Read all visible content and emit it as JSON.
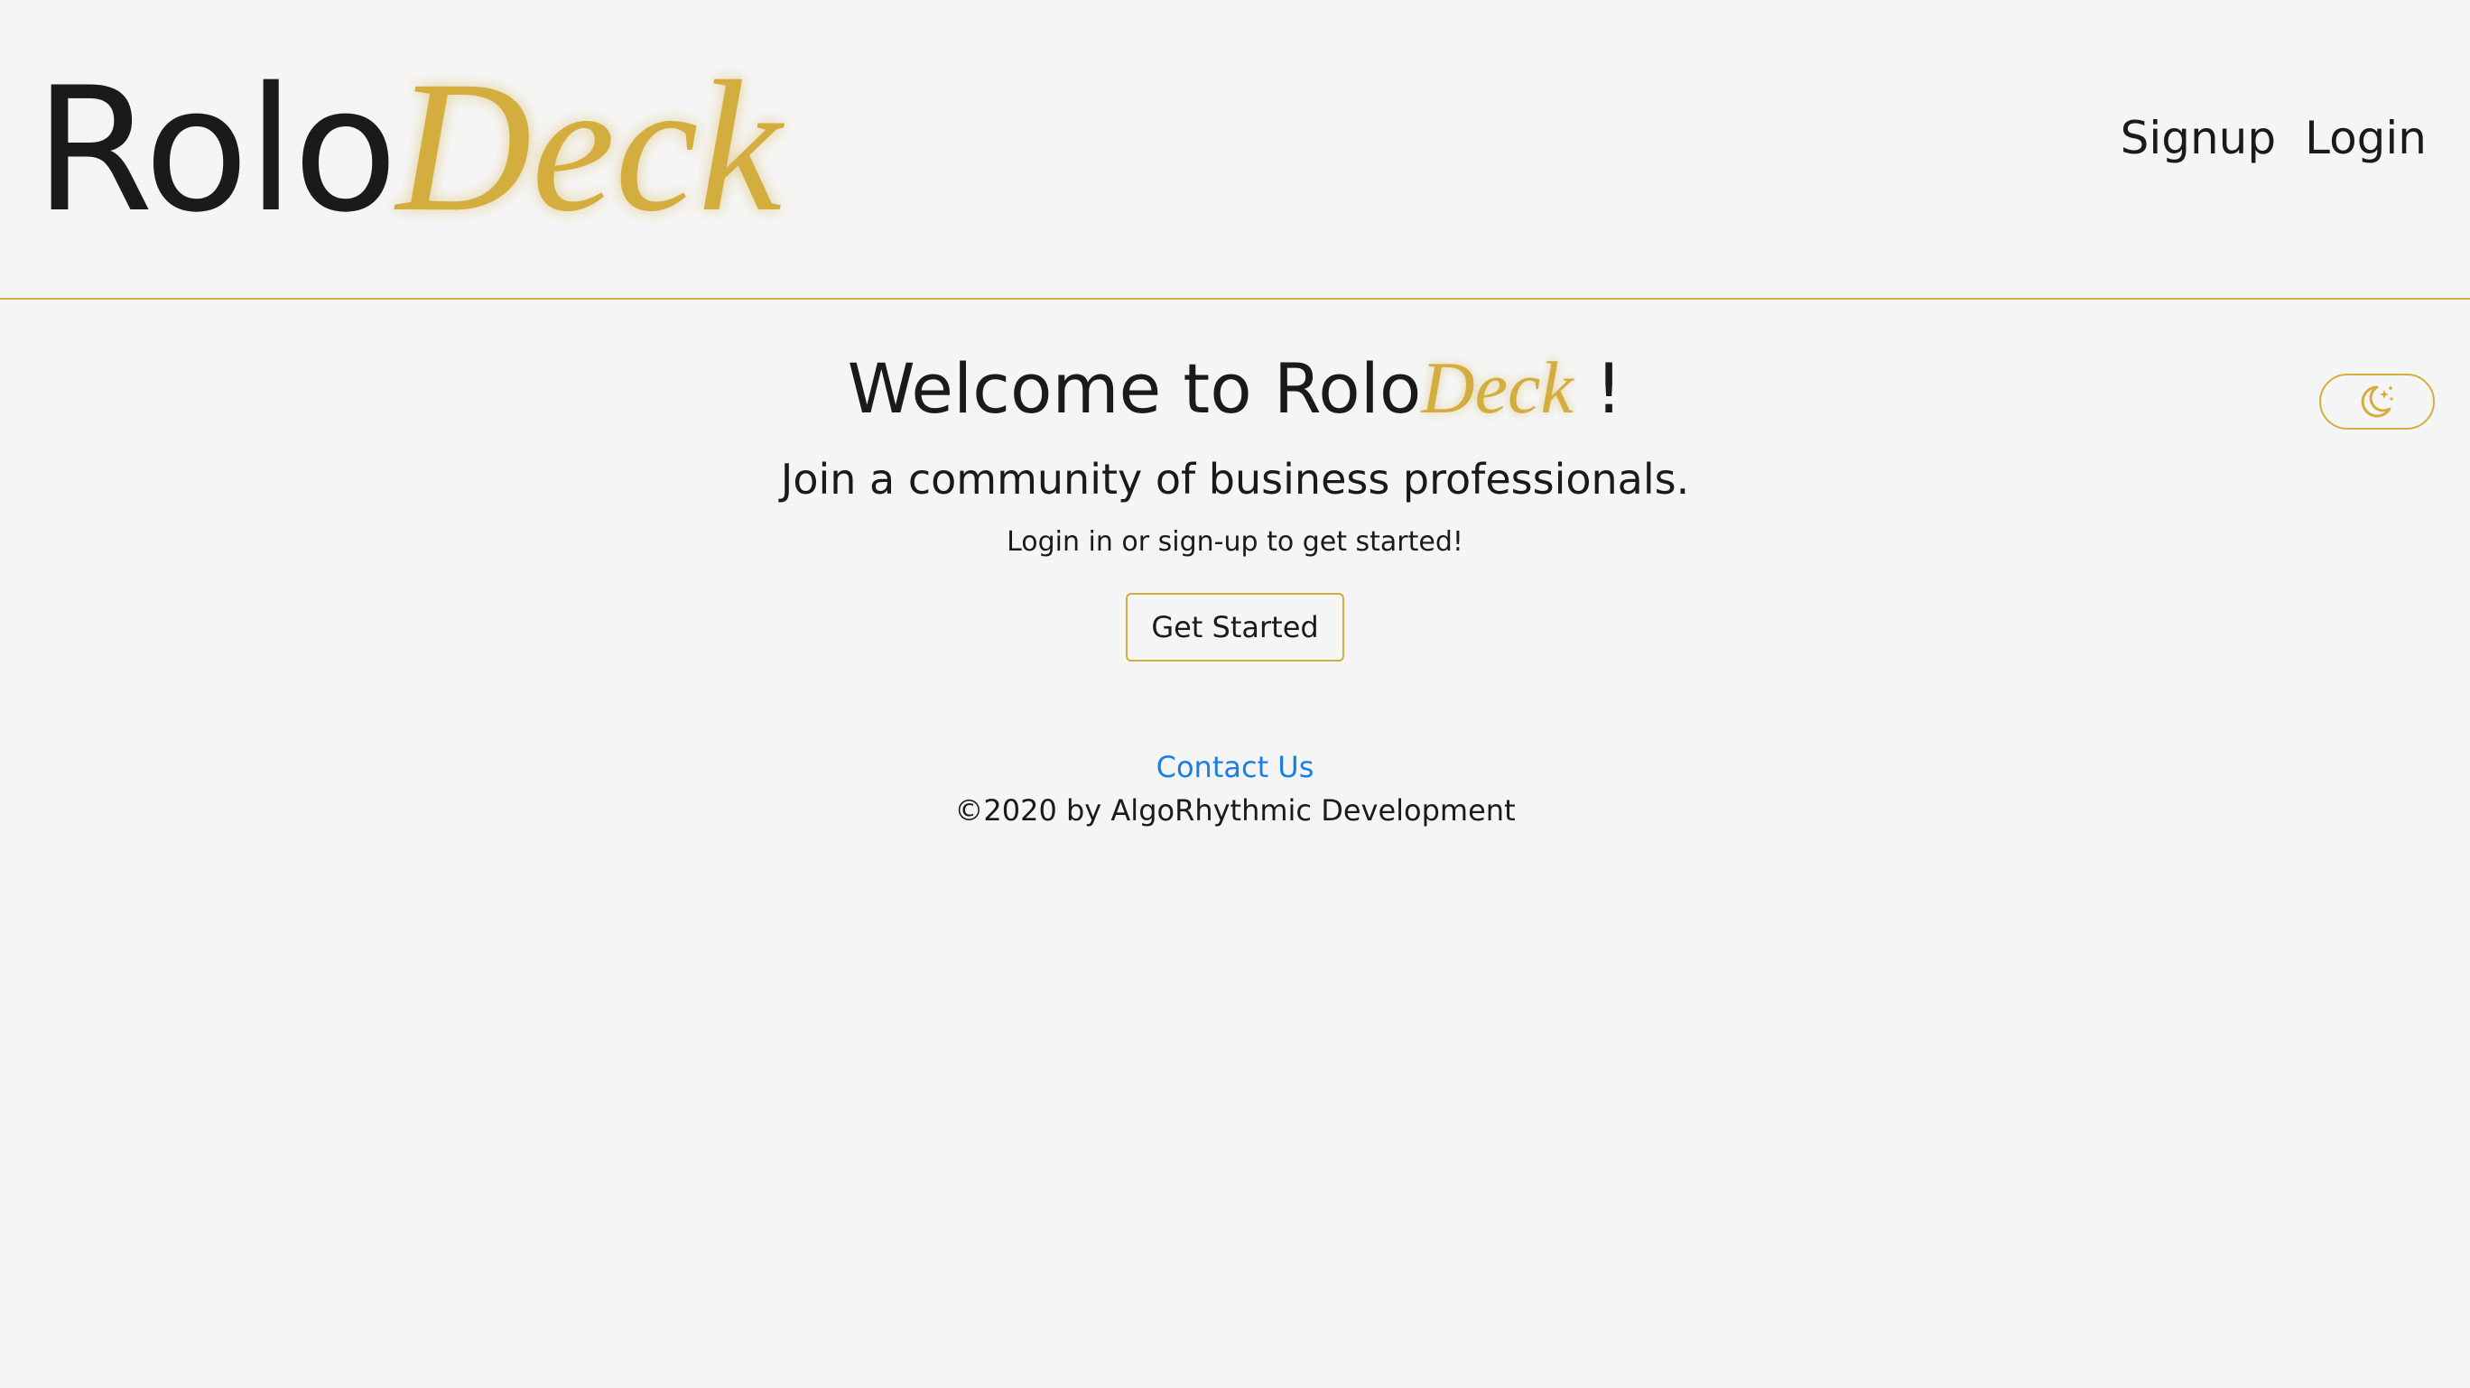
{
  "brand": {
    "name_part1": "Rolo",
    "name_part2": "Deck",
    "accent_color": "#d4ad3f"
  },
  "nav": {
    "items": [
      {
        "label": "Signup"
      },
      {
        "label": "Login"
      }
    ]
  },
  "theme_toggle": {
    "icon": "moon-stars-icon"
  },
  "hero": {
    "welcome_prefix": "Welcome to Rolo",
    "welcome_brand": "Deck",
    "welcome_suffix": " !",
    "subtitle": "Join a community of business professionals.",
    "prompt": "Login in or sign-up to get started!",
    "button_label": "Get Started"
  },
  "footer": {
    "contact_label": "Contact Us",
    "copyright": "©2020 by AlgoRhythmic Development",
    "link_color": "#1a7ee8"
  }
}
